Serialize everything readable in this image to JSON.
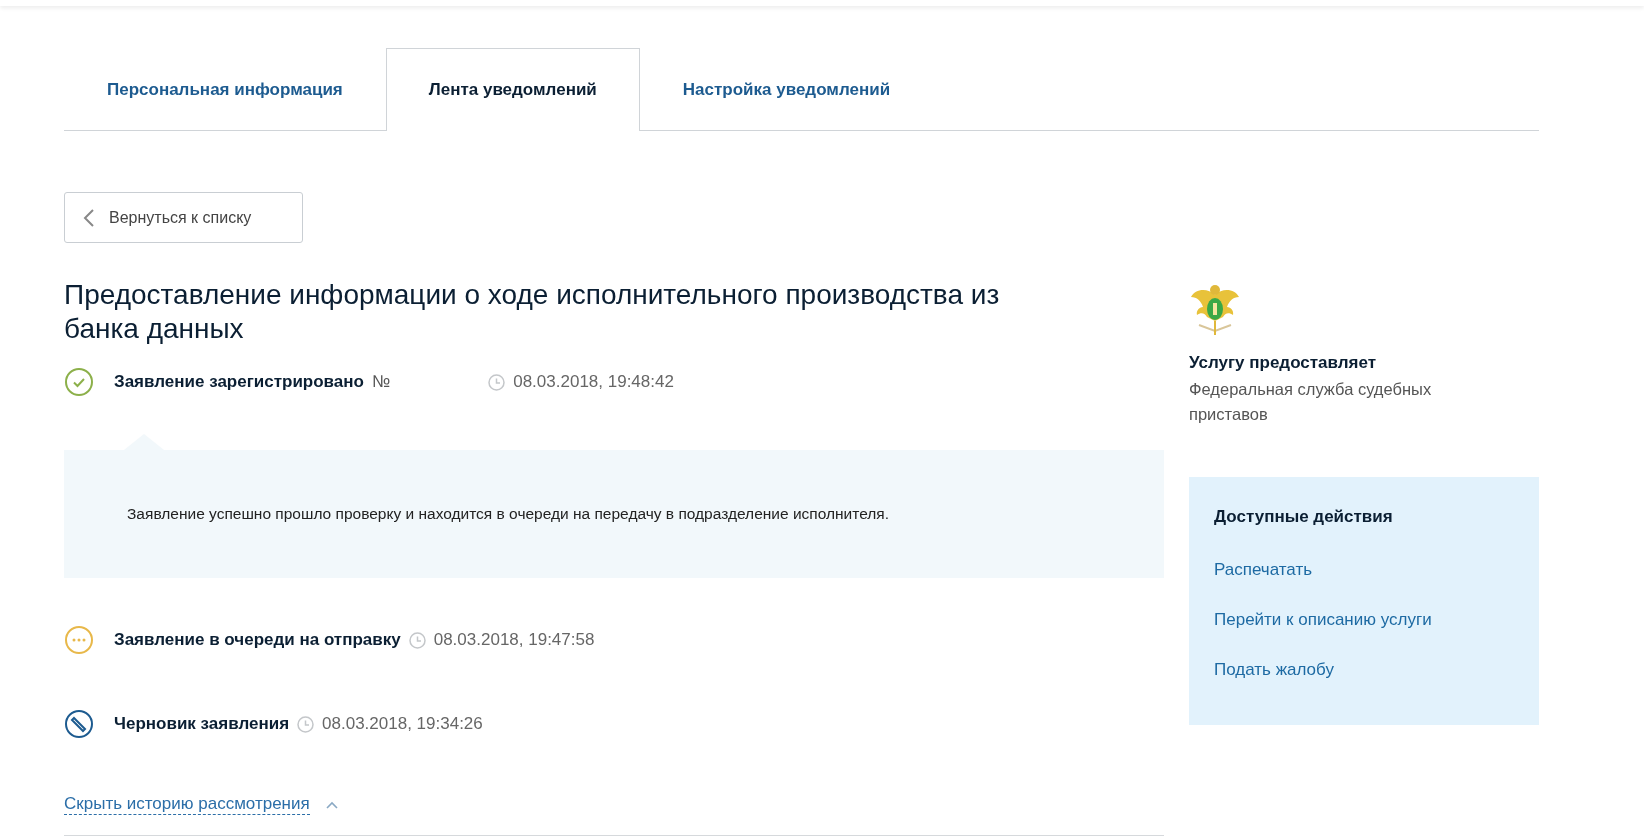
{
  "tabs": [
    {
      "label": "Персональная информация",
      "selected": false
    },
    {
      "label": "Лента уведомлений",
      "selected": true
    },
    {
      "label": "Настройка уведомлений",
      "selected": false
    }
  ],
  "back_button": {
    "label": "Вернуться к списку"
  },
  "title": "Предоставление информации о ходе исполнительного производства из банка данных",
  "history": [
    {
      "kind": "registered",
      "status": "Заявление зарегистрировано",
      "number_label": "№",
      "time": "08.03.2018, 19:48:42",
      "expanded": true,
      "detail": "Заявление успешно прошло проверку и находится в очереди на передачу в подразделение исполнителя."
    },
    {
      "kind": "queued",
      "status": "Заявление в очереди на отправку",
      "time": "08.03.2018, 19:47:58",
      "expanded": false
    },
    {
      "kind": "draft",
      "status": "Черновик заявления",
      "time": "08.03.2018, 19:34:26",
      "expanded": false
    }
  ],
  "history_toggle": {
    "label": "Скрыть историю рассмотрения",
    "expanded": true
  },
  "provider": {
    "heading": "Услугу предоставляет",
    "name": "Федеральная служба судебных приставов"
  },
  "actions": {
    "heading": "Доступные действия",
    "links": [
      "Распечатать",
      "Перейти к описанию услуги",
      "Подать жалобу"
    ]
  }
}
